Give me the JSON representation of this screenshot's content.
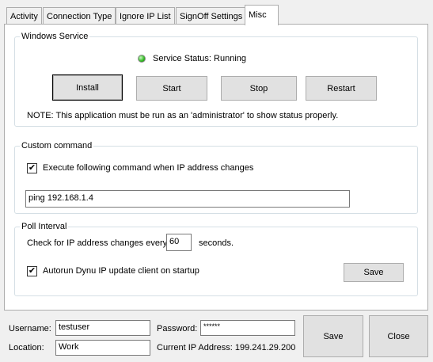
{
  "tabs": [
    {
      "label": "Activity"
    },
    {
      "label": "Connection Type"
    },
    {
      "label": "Ignore IP List"
    },
    {
      "label": "SignOff Settings"
    },
    {
      "label": "Misc"
    }
  ],
  "windows_service": {
    "title": "Windows Service",
    "status_text": "Service Status: Running",
    "status_color": "#2fb820",
    "install_label": "Install",
    "start_label": "Start",
    "stop_label": "Stop",
    "restart_label": "Restart",
    "note": "NOTE: This application must be run as an 'administrator' to show status properly."
  },
  "custom_command": {
    "title": "Custom command",
    "checkbox_checked": true,
    "checkbox_label": "Execute following command when IP address changes",
    "command_value": "ping 192.168.1.4"
  },
  "poll_interval": {
    "title": "Poll Interval",
    "prefix_label": "Check for IP address changes every",
    "interval_value": "60",
    "suffix_label": "seconds.",
    "autorun_checked": true,
    "autorun_label": "Autorun Dynu IP update client on startup",
    "save_label": "Save"
  },
  "footer": {
    "username_label": "Username:",
    "username_value": "testuser",
    "password_label": "Password:",
    "password_value": "******",
    "location_label": "Location:",
    "location_value": "Work",
    "current_ip_label": "Current IP Address: 199.241.29.200",
    "save_label": "Save",
    "close_label": "Close"
  }
}
